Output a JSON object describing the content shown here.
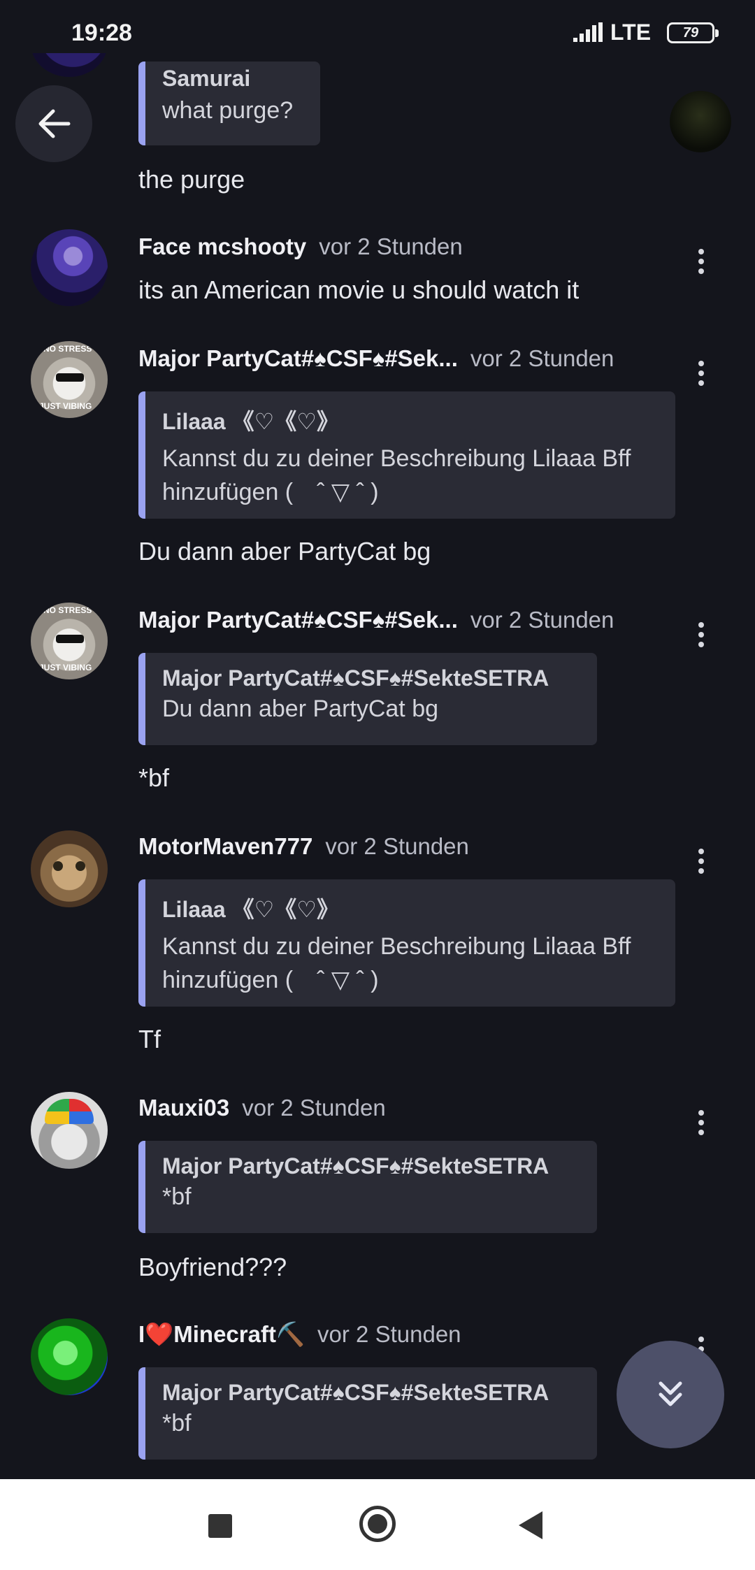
{
  "status_bar": {
    "time": "19:28",
    "network": "LTE",
    "battery": "79"
  },
  "messages": [
    {
      "quote": {
        "author": "Samurai",
        "text": "what purge?"
      },
      "text": "the purge"
    },
    {
      "username": "Face mcshooty",
      "timestamp": "vor 2 Stunden",
      "text": "its an American movie u should watch it"
    },
    {
      "username": "Major PartyCat#♠CSF♠#Sek...",
      "timestamp": "vor 2 Stunden",
      "quote": {
        "author": "Lilaaa 《♡《♡》",
        "text": "Kannst du zu deiner Beschreibung Lilaaa Bff hinzufügen (　ˆ ▽ ˆ )"
      },
      "text": "Du dann aber PartyCat bg"
    },
    {
      "username": "Major PartyCat#♠CSF♠#Sek...",
      "timestamp": "vor 2 Stunden",
      "quote": {
        "author": "Major PartyCat#♠CSF♠#SekteSETRA",
        "text": "Du dann aber PartyCat bg"
      },
      "text": "*bf"
    },
    {
      "username": "MotorMaven777",
      "timestamp": "vor 2 Stunden",
      "quote": {
        "author": "Lilaaa 《♡《♡》",
        "text": "Kannst du zu deiner Beschreibung Lilaaa Bff hinzufügen (　ˆ ▽ ˆ )"
      },
      "text": "Tf"
    },
    {
      "username": "Mauxi03",
      "timestamp": "vor 2 Stunden",
      "quote": {
        "author": "Major PartyCat#♠CSF♠#SekteSETRA",
        "text": "*bf"
      },
      "text": "Boyfriend???"
    },
    {
      "username": "I❤️Minecraft⛏️",
      "timestamp": "vor 2 Stunden",
      "quote": {
        "author": "Major PartyCat#♠CSF♠#SekteSETRA",
        "text": "*bf"
      }
    }
  ],
  "avatar_text": {
    "top": "NO STRESS",
    "bottom": "JUST VIBING"
  },
  "colors": {
    "background": "#14151c",
    "quote_bar": "#9aa2f0",
    "fab": "#4d5069"
  }
}
